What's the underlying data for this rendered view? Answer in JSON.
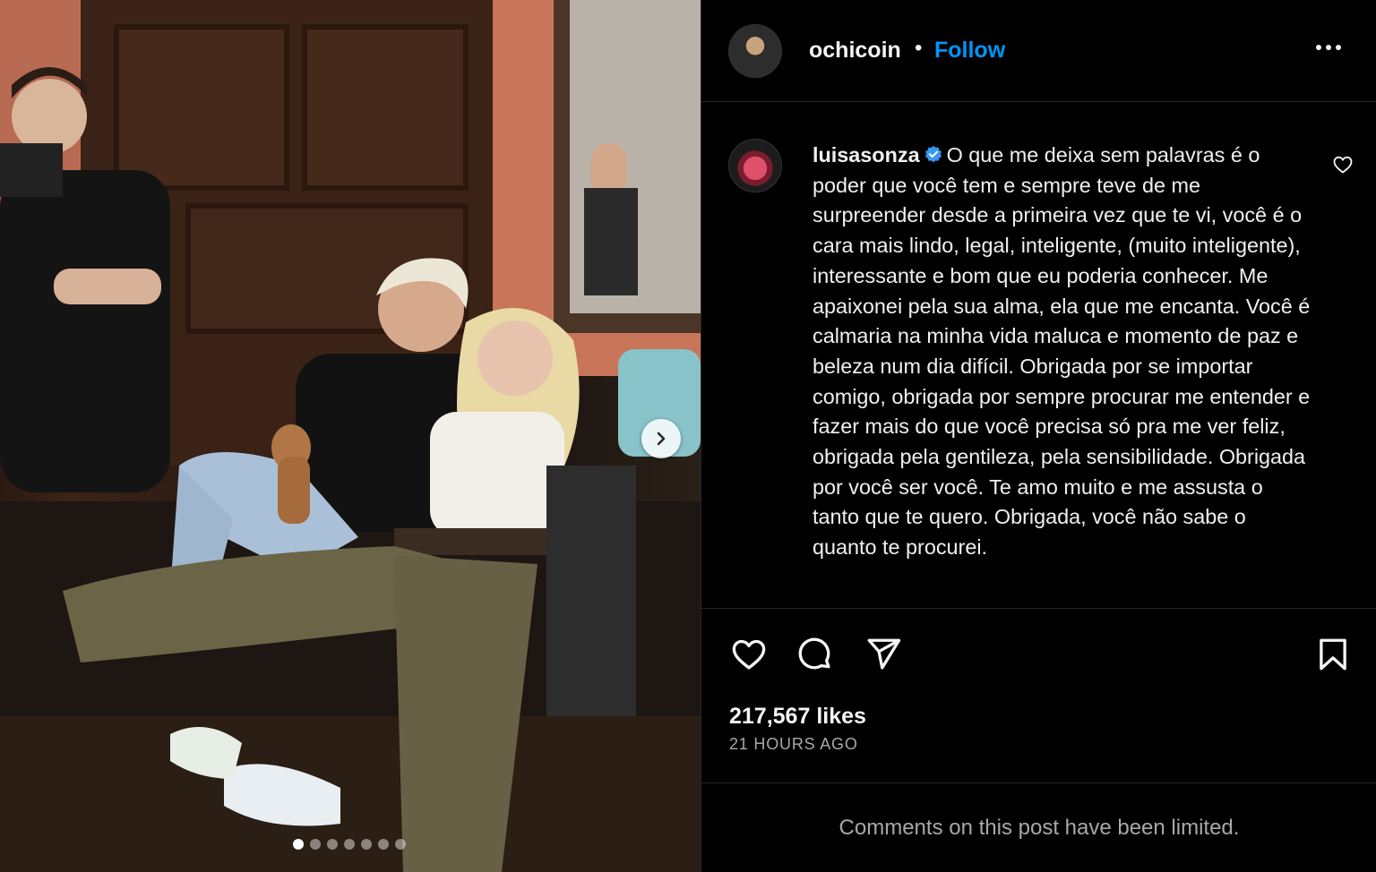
{
  "post": {
    "carousel": {
      "slide_count": 7,
      "active_slide": 1
    },
    "author": {
      "username": "ochicoin",
      "separator": "•",
      "follow_label": "Follow"
    },
    "caption": {
      "username": "luisasonza",
      "verified": true,
      "text": "O que me deixa sem palavras é o poder que você tem e sempre teve de me surpreender desde a primeira vez que te vi, você é o cara mais lindo, legal, inteligente, (muito inteligente), interessante e bom que eu poderia conhecer. Me apaixonei pela sua alma, ela que me encanta. Você é calmaria na minha vida maluca e momento de paz e beleza num dia difícil. Obrigada por se importar comigo, obrigada por sempre procurar me entender e fazer mais do que você precisa só pra me ver feliz, obrigada pela gentileza, pela sensibilidade. Obrigada por você ser você. Te amo muito e me assusta o tanto que te quero. Obrigada, você não sabe o quanto te procurei."
    },
    "likes": "217,567 likes",
    "timestamp": "21 HOURS AGO",
    "comments_notice": "Comments on this post have been limited."
  },
  "icons": {
    "verified": "verified-badge-icon",
    "like": "heart-icon",
    "comment": "comment-bubble-icon",
    "share": "paper-plane-icon",
    "save": "bookmark-icon",
    "more": "more-options-icon",
    "next": "chevron-right-icon"
  },
  "colors": {
    "background": "#000000",
    "follow": "#0095f6",
    "verified": "#3897f0",
    "muted": "#a8a8a8"
  }
}
